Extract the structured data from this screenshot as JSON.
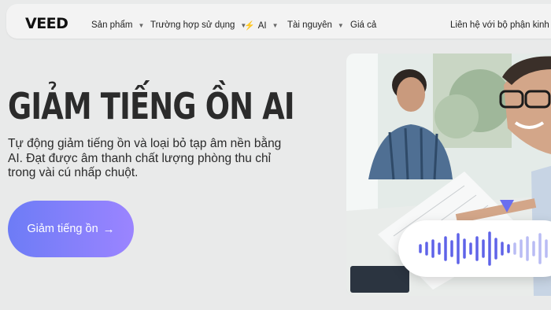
{
  "nav": {
    "logo": "VEED",
    "items": [
      {
        "label": "Sản phẩm",
        "icon": "chevron-down-icon"
      },
      {
        "label": "Trường hợp sử dụng",
        "icon": "chevron-down-icon"
      },
      {
        "label": "AI",
        "icon": "bolt-icon"
      },
      {
        "label": "Tài nguyên",
        "icon": "chevron-down-icon"
      },
      {
        "label": "Giá cả"
      }
    ],
    "contact": "Liên hệ với bộ phận kinh doanh"
  },
  "hero": {
    "title": "GIẢM TIẾNG ỒN AI",
    "description": "Tự động giảm tiếng ồn và loại bỏ tạp âm nền bằng AI. Đạt được âm thanh chất lượng phòng thu chỉ trong vài cú nhấp chuột.",
    "cta": "Giảm tiếng ồn",
    "cta_icon": "arrow-right-icon"
  },
  "colors": {
    "accent_start": "#6d7cf6",
    "accent_end": "#9b84ff",
    "waveform": "#5f63e8"
  }
}
